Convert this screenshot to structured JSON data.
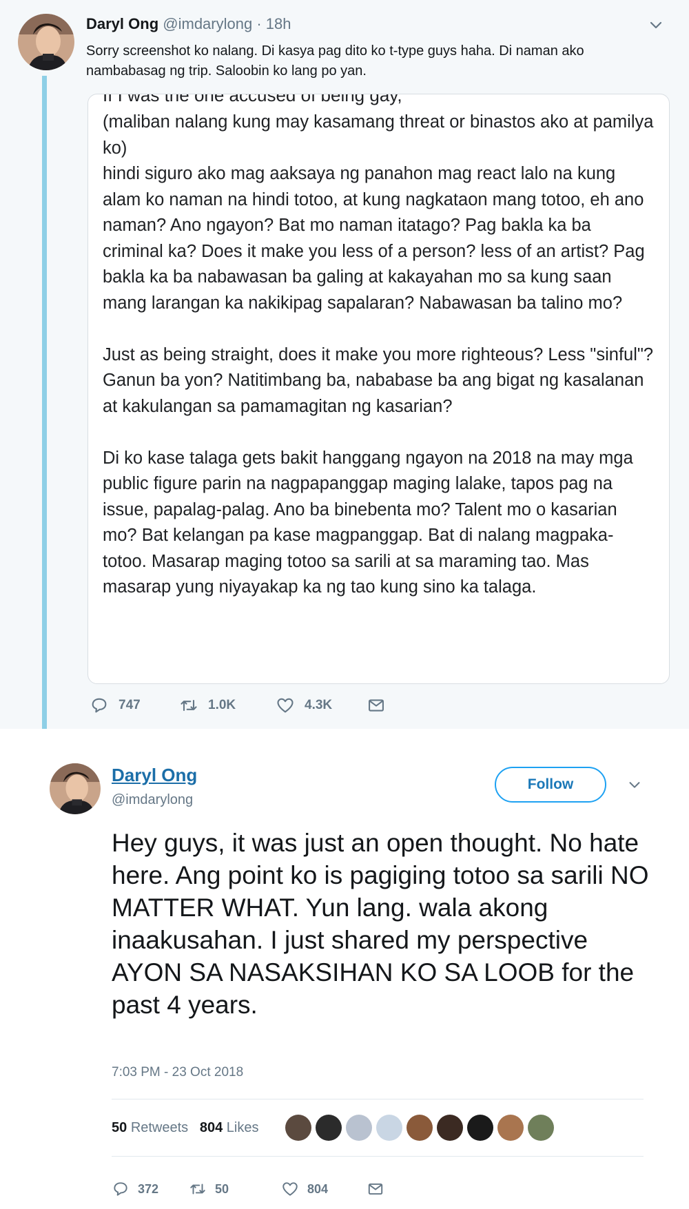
{
  "tweet1": {
    "author_name": "Daryl Ong",
    "handle": "@imdarylong",
    "separator": "·",
    "time": "18h",
    "text": "Sorry screenshot ko nalang. Di kasya pag dito ko t-type guys haha. Di naman ako nambabasag ng trip. Saloobin ko lang po yan.",
    "card": {
      "cut_line": "If I was the one accused of being gay,",
      "paragraphs": [
        "(maliban nalang kung may kasamang threat or binastos ako at pamilya ko)\nhindi siguro ako mag aaksaya ng panahon mag react lalo na kung alam ko naman na hindi totoo, at kung nagkataon mang totoo, eh ano naman? Ano ngayon? Bat mo naman itatago? Pag bakla ka ba criminal ka? Does it make you less of a person? less of an artist? Pag bakla ka ba nabawasan ba galing at kakayahan mo sa kung saan mang larangan ka nakikipag sapalaran? Nabawasan ba talino mo?",
        "Just as being straight, does it make you more righteous? Less \"sinful\"? Ganun ba yon? Natitimbang ba, nababase ba ang bigat ng kasalanan at kakulangan sa pamamagitan ng kasarian?",
        "Di ko kase talaga gets bakit hanggang ngayon na 2018 na may mga public figure parin na nagpapanggap maging lalake, tapos pag na issue, papalag-palag. Ano ba binebenta mo? Talent mo o kasarian mo? Bat kelangan pa kase magpanggap. Bat di nalang magpaka-totoo. Masarap maging totoo sa sarili at sa maraming tao. Mas masarap yung niyayakap ka ng tao kung sino ka talaga."
      ]
    },
    "actions": {
      "replies": "747",
      "retweets": "1.0K",
      "likes": "4.3K"
    },
    "icons": [
      "reply-icon",
      "retweet-icon",
      "like-icon",
      "message-icon",
      "chevron-down-icon"
    ]
  },
  "tweet2": {
    "author_name": "Daryl Ong",
    "handle": "@imdarylong",
    "follow_label": "Follow",
    "text": "Hey guys, it was just an open thought. No hate here. Ang point ko is pagiging totoo sa sarili NO MATTER WHAT. Yun lang. wala akong inaakusahan. I just shared my perspective AYON SA NASAKSIHAN KO SA LOOB for the past 4 years.",
    "timestamp": "7:03 PM - 23 Oct 2018",
    "stats": {
      "retweets_count": "50",
      "retweets_label": "Retweets",
      "likes_count": "804",
      "likes_label": "Likes"
    },
    "actions": {
      "replies": "372",
      "retweets": "50",
      "likes": "804"
    },
    "liker_avatar_colors": [
      "#5b4a3f",
      "#2b2b2b",
      "#b9c2d0",
      "#c9d6e4",
      "#8a5a3a",
      "#3b2a22",
      "#1a1a1a",
      "#a9754f",
      "#6f7f5a"
    ]
  },
  "colors": {
    "accent": "#1da1f2",
    "thread_line": "#8ecfe6",
    "muted": "#657786",
    "link": "#1b6ea8"
  }
}
